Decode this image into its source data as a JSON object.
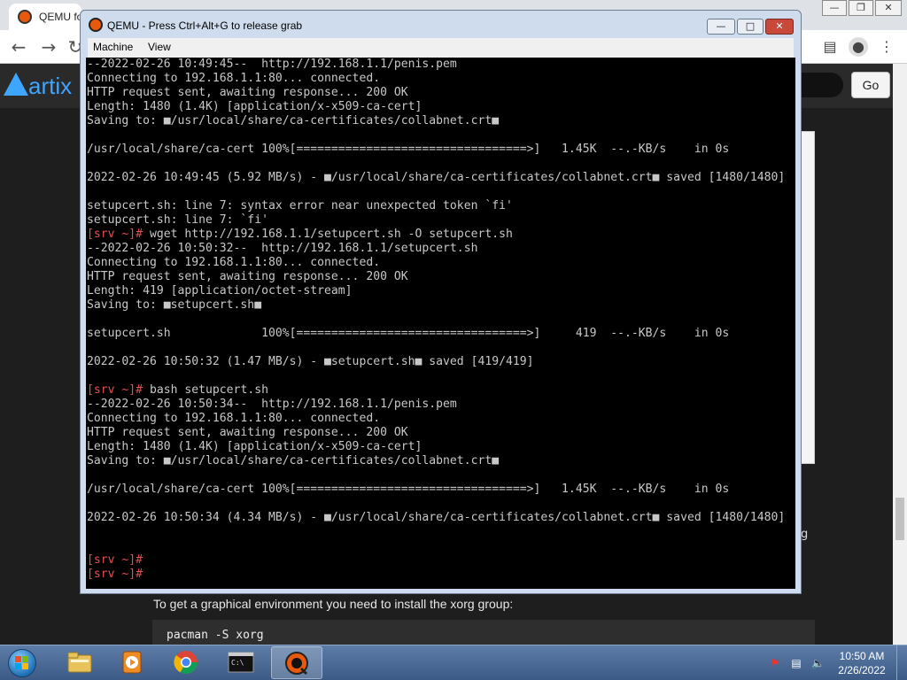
{
  "browser": {
    "tab_title": "QEMU fo",
    "go_label": "Go",
    "site_logo": "artix",
    "page_text": "To get a graphical environment you need to install the xorg group:",
    "code_text": "pacman -S xorg",
    "side_text": "g"
  },
  "qemu": {
    "title": "QEMU - Press Ctrl+Alt+G to release grab",
    "menu": [
      {
        "label": "Machine"
      },
      {
        "label": "View"
      }
    ]
  },
  "terminal_lines": [
    {
      "t": "--2022-02-26 10:49:45--  http://192.168.1.1/penis.pem"
    },
    {
      "t": "Connecting to 192.168.1.1:80... connected."
    },
    {
      "t": "HTTP request sent, awaiting response... 200 OK"
    },
    {
      "t": "Length: 1480 (1.4K) [application/x-x509-ca-cert]"
    },
    {
      "t": "Saving to: ■/usr/local/share/ca-certificates/collabnet.crt■"
    },
    {
      "t": ""
    },
    {
      "t": "/usr/local/share/ca-cert 100%[=================================>]   1.45K  --.-KB/s    in 0s"
    },
    {
      "t": ""
    },
    {
      "t": "2022-02-26 10:49:45 (5.92 MB/s) - ■/usr/local/share/ca-certificates/collabnet.crt■ saved [1480/1480]"
    },
    {
      "t": ""
    },
    {
      "t": "setupcert.sh: line 7: syntax error near unexpected token `fi'"
    },
    {
      "t": "setupcert.sh: line 7: `fi'"
    },
    {
      "p": "[srv ~]#",
      "t": " wget http://192.168.1.1/setupcert.sh -O setupcert.sh"
    },
    {
      "t": "--2022-02-26 10:50:32--  http://192.168.1.1/setupcert.sh"
    },
    {
      "t": "Connecting to 192.168.1.1:80... connected."
    },
    {
      "t": "HTTP request sent, awaiting response... 200 OK"
    },
    {
      "t": "Length: 419 [application/octet-stream]"
    },
    {
      "t": "Saving to: ■setupcert.sh■"
    },
    {
      "t": ""
    },
    {
      "t": "setupcert.sh             100%[=================================>]     419  --.-KB/s    in 0s"
    },
    {
      "t": ""
    },
    {
      "t": "2022-02-26 10:50:32 (1.47 MB/s) - ■setupcert.sh■ saved [419/419]"
    },
    {
      "t": ""
    },
    {
      "p": "[srv ~]#",
      "t": " bash setupcert.sh"
    },
    {
      "t": "--2022-02-26 10:50:34--  http://192.168.1.1/penis.pem"
    },
    {
      "t": "Connecting to 192.168.1.1:80... connected."
    },
    {
      "t": "HTTP request sent, awaiting response... 200 OK"
    },
    {
      "t": "Length: 1480 (1.4K) [application/x-x509-ca-cert]"
    },
    {
      "t": "Saving to: ■/usr/local/share/ca-certificates/collabnet.crt■"
    },
    {
      "t": ""
    },
    {
      "t": "/usr/local/share/ca-cert 100%[=================================>]   1.45K  --.-KB/s    in 0s"
    },
    {
      "t": ""
    },
    {
      "t": "2022-02-26 10:50:34 (4.34 MB/s) - ■/usr/local/share/ca-certificates/collabnet.crt■ saved [1480/1480]"
    },
    {
      "t": ""
    },
    {
      "t": ""
    },
    {
      "p": "[srv ~]#",
      "t": ""
    },
    {
      "p": "[srv ~]#",
      "t": ""
    }
  ],
  "taskbar": {
    "clock_time": "10:50 AM",
    "clock_date": "2/26/2022"
  },
  "colors": {
    "terminal_bg": "#000000",
    "terminal_fg": "#c8c8c8",
    "prompt": "#e05050",
    "window_frame": "#cfdced",
    "taskbar": "#3b5a85"
  }
}
